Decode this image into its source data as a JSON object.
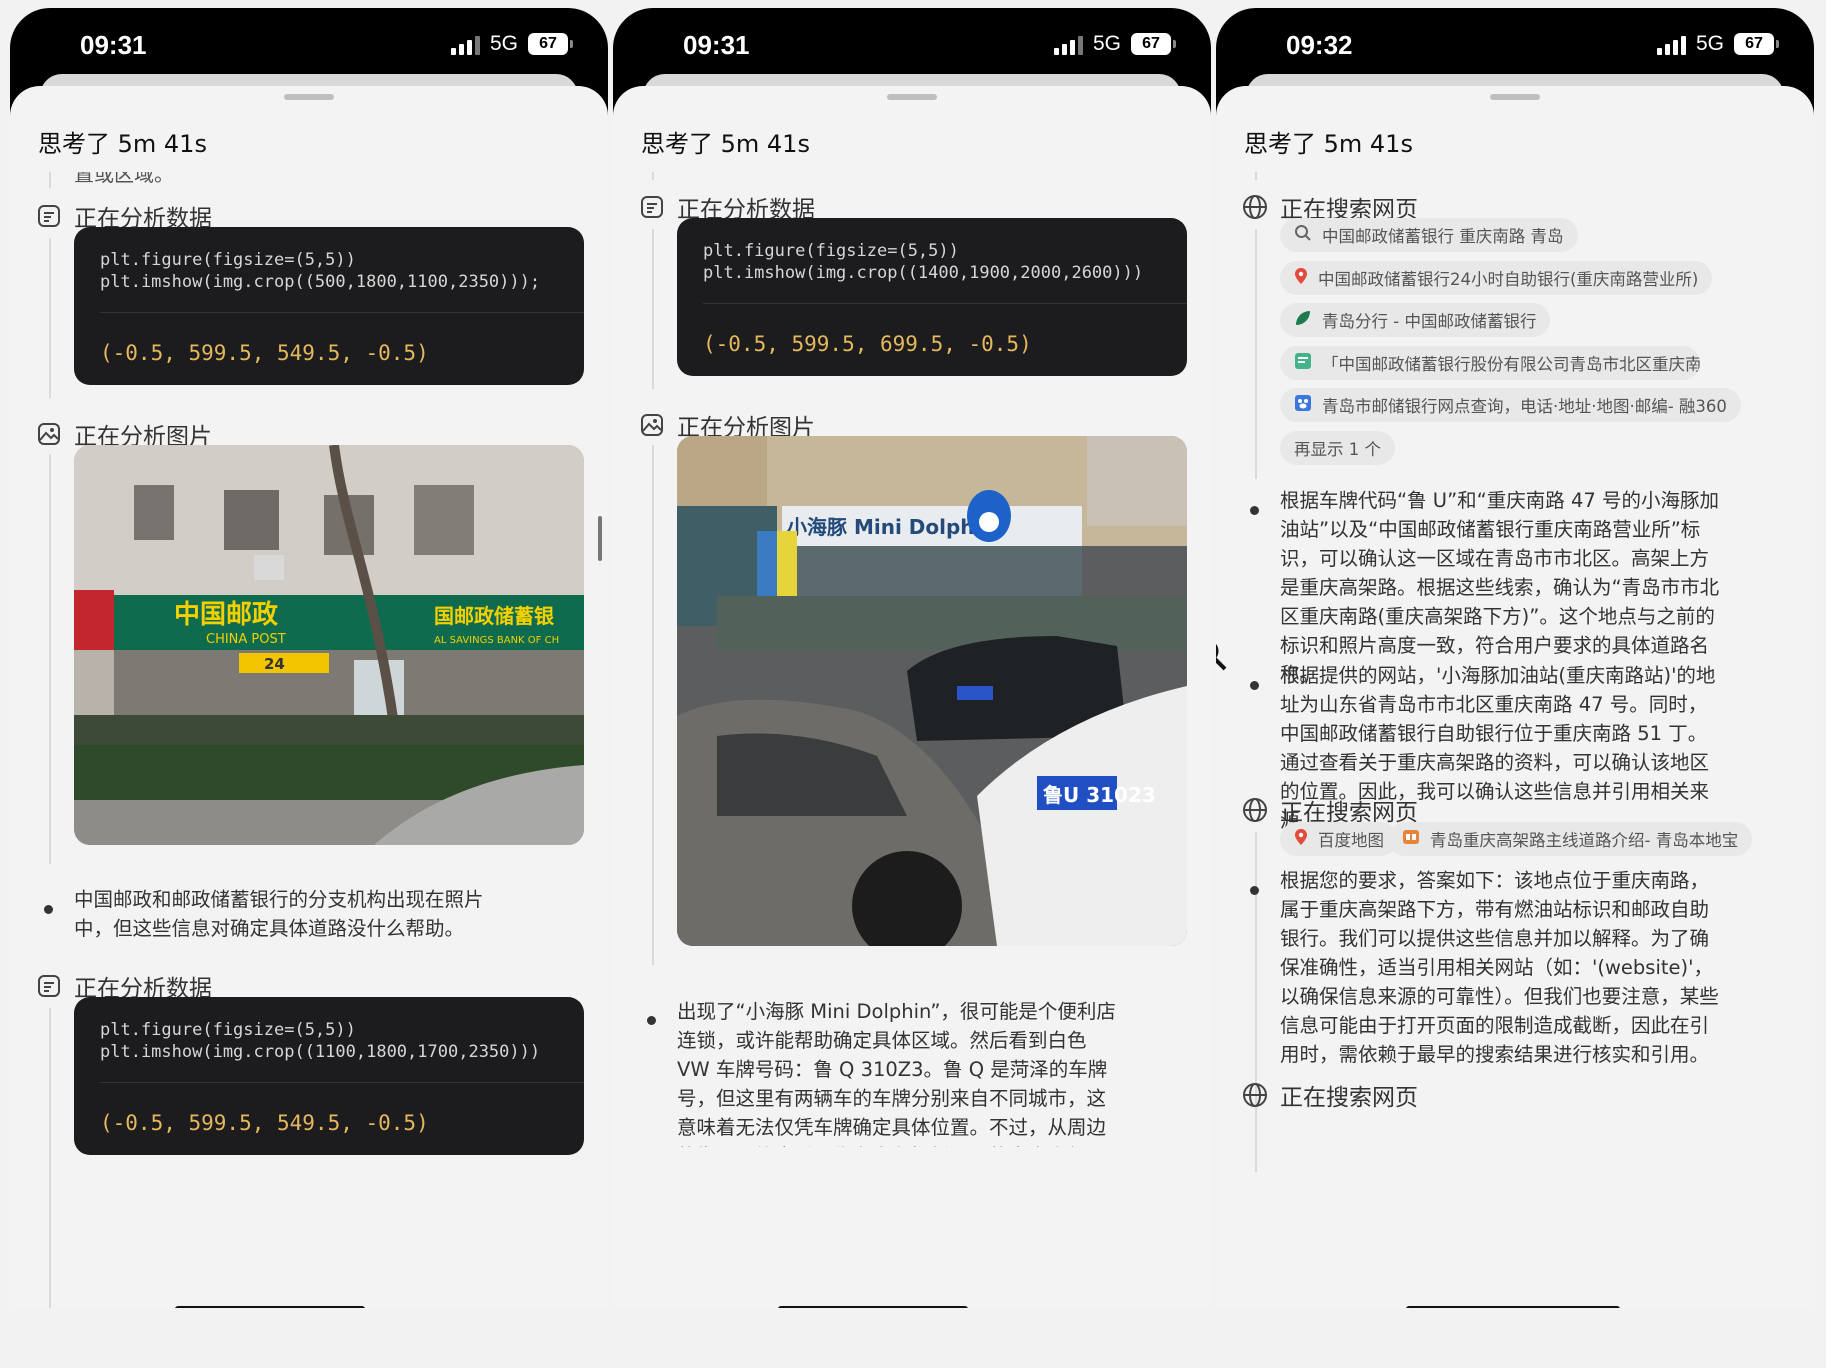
{
  "phones": [
    {
      "time": "09:31",
      "network": "5G",
      "battery": "67",
      "header": "思考了 5m 41s",
      "clipped_top": "置或区域。",
      "step1": "正在分析数据",
      "code1": {
        "line1": "plt.figure(figsize=(5,5))",
        "line2": "plt.imshow(img.crop((500,1800,1100,2350)));",
        "output": "(-0.5, 599.5, 549.5, -0.5)"
      },
      "step2": "正在分析图片",
      "photo_signs": {
        "cn": "中国邮政",
        "en": "CHINA POST",
        "bank": "国邮政储蓄银",
        "bank_en": "AL SAVINGS BANK OF CH",
        "hours": "24"
      },
      "bullet1": "中国邮政和邮政储蓄银行的分支机构出现在照片中，但这些信息对确定具体道路没什么帮助。",
      "step3": "正在分析数据",
      "code2": {
        "line1": "plt.figure(figsize=(5,5))",
        "line2": "plt.imshow(img.crop((1100,1800,1700,2350)))",
        "output": "(-0.5, 599.5, 549.5, -0.5)"
      }
    },
    {
      "time": "09:31",
      "network": "5G",
      "battery": "67",
      "header": "思考了 5m 41s",
      "step1": "正在分析数据",
      "code1": {
        "line1": "plt.figure(figsize=(5,5))",
        "line2": "plt.imshow(img.crop((1400,1900,2000,2600)))",
        "output": "(-0.5, 599.5, 699.5, -0.5)"
      },
      "step2": "正在分析图片",
      "photo_signs": {
        "station": "小海豚 Mini Dolphin",
        "plate": "鲁U 31023"
      },
      "bullet1": "出现了“小海豚 Mini Dolphin”，很可能是个便利店连锁，或许能帮助确定具体区域。然后看到白色 VW 车牌号码：鲁 Q 310Z3。鲁 Q 是菏泽的车牌号，但这里有两辆车的车牌分别来自不同城市，这意味着无法仅凭车牌确定具体位置。不过，从周边的街景设施来看，像有白色栅栏隔开的中央人行道，可能是在青岛西海岸的长江中路上。我可以进一步搜索西海岸快速线在长江中路"
    },
    {
      "time": "09:32",
      "network": "5G",
      "battery": "67",
      "header": "思考了 5m 41s",
      "step1": "正在搜索网页",
      "chips1": [
        {
          "icon": "search",
          "text": "中国邮政储蓄银行 重庆南路 青岛"
        },
        {
          "icon": "pin",
          "text": "中国邮政储蓄银行24小时自助银行(重庆南路营业所)"
        },
        {
          "icon": "leaf",
          "text": "青岛分行 - 中国邮政储蓄银行"
        },
        {
          "icon": "doc",
          "text": "「中国邮政储蓄银行股份有限公司青岛市北区重庆南路营业..."
        },
        {
          "icon": "paw",
          "text": "青岛市邮储银行网点查询，电话·地址·地图·邮编- 融360"
        },
        {
          "icon": "",
          "text": "再显示 1 个"
        }
      ],
      "bullet1": "根据车牌代码“鲁 U”和“重庆南路 47 号的小海豚加油站”以及“中国邮政储蓄银行重庆南路营业所”标识，可以确认这一区域在青岛市市北区。高架上方是重庆高架路。根据这些线索，确认为“青岛市市北区重庆南路(重庆高架路下方)”。这个地点与之前的标识和照片高度一致，符合用户要求的具体道路名称。",
      "bullet2": "根据提供的网站，'小海豚加油站(重庆南路站)'的地址为山东省青岛市市北区重庆南路 47 号。同时，中国邮政储蓄银行自助银行位于重庆南路 51 丁。通过查看关于重庆高架路的资料，可以确认该地区的位置。因此，我可以确认这些信息并引用相关来源。",
      "step2": "正在搜索网页",
      "chips2": [
        {
          "icon": "pin",
          "text": "百度地图"
        },
        {
          "icon": "img",
          "text": "青岛重庆高架路主线道路介绍- 青岛本地宝"
        }
      ],
      "bullet3": "根据您的要求，答案如下：该地点位于重庆南路，属于重庆高架路下方，带有燃油站标识和邮政自助银行。我们可以提供这些信息并加以解释。为了确保准确性，适当引用相关网站（如：'(website)'，以确保信息来源的可靠性）。但我们也要注意，某些信息可能由于打开页面的限制造成截断，因此在引用时，需依赖于最早的搜索结果进行核实和引用。",
      "step3": "正在搜索网页"
    }
  ]
}
